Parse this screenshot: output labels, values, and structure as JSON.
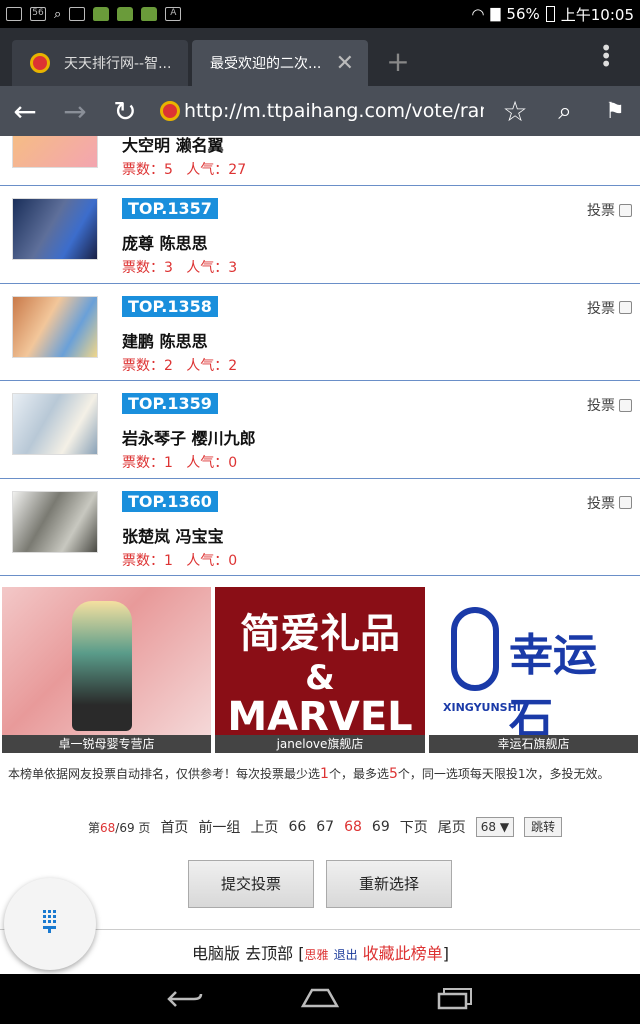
{
  "status": {
    "sim": "56",
    "battery": "56%",
    "time": "上午10:05"
  },
  "tabs": [
    {
      "title": "天天排行网--智..."
    },
    {
      "title": "最受欢迎的二次..."
    }
  ],
  "address": {
    "url": "http://m.ttpaihang.com/vote/rank"
  },
  "partial_item": {
    "names": "大空明 濑名翼",
    "votes": "票数：5",
    "popularity": "人气：27"
  },
  "items": [
    {
      "rank": "TOP.1357",
      "names": "庞尊 陈思思",
      "votes": "票数：3",
      "popularity": "人气：3",
      "vote_label": "投票"
    },
    {
      "rank": "TOP.1358",
      "names": "建鹏 陈思思",
      "votes": "票数：2",
      "popularity": "人气：2",
      "vote_label": "投票"
    },
    {
      "rank": "TOP.1359",
      "names": "岩永琴子 樱川九郎",
      "votes": "票数：1",
      "popularity": "人气：0",
      "vote_label": "投票"
    },
    {
      "rank": "TOP.1360",
      "names": "张楚岚 冯宝宝",
      "votes": "票数：1",
      "popularity": "人气：0",
      "vote_label": "投票"
    }
  ],
  "ads": [
    {
      "caption": "卓一锐母婴专营店"
    },
    {
      "caption": "janelove旗舰店",
      "line1": "简爱礼品",
      "line2": "&",
      "line3": "MARVEL"
    },
    {
      "caption": "幸运石旗舰店",
      "brand": "幸运石",
      "pinyin": "XINGYUNSHI"
    }
  ],
  "notice": {
    "p1": "本榜单依据网友投票自动排名，仅供参考！每次投票最少选",
    "min": "1",
    "p2": "个，最多选",
    "max": "5",
    "p3": "个，同一选项每天限投1次，多投无效。"
  },
  "pager": {
    "page_prefix": "第",
    "current": "68",
    "total_suffix": "/69 页",
    "first": "首页",
    "prev_group": "前一组",
    "prev": "上页",
    "p66": "66",
    "p67": "67",
    "p68": "68",
    "p69": "69",
    "next": "下页",
    "last": "尾页",
    "select_value": "68",
    "jump": "跳转"
  },
  "buttons": {
    "submit": "提交投票",
    "reset": "重新选择"
  },
  "footer": {
    "pc": "电脑版",
    "top": "去顶部",
    "user": "思雅",
    "logout": "退出",
    "bookmark": "收藏此榜单"
  }
}
